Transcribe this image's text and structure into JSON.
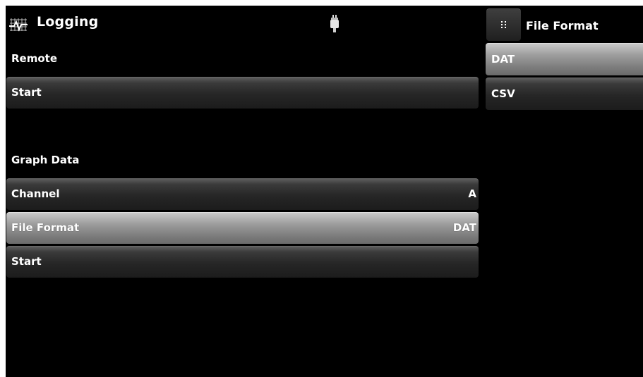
{
  "header": {
    "title": "Logging",
    "title_icon": "logging-graph-icon",
    "status_icon": "usb-connector-icon"
  },
  "remote": {
    "label": "Remote",
    "start_label": "Start"
  },
  "graph": {
    "label": "Graph Data",
    "channel_label": "Channel",
    "channel_value": "A",
    "file_format_label": "File Format",
    "file_format_value": "DAT",
    "start_label": "Start"
  },
  "file_format_panel": {
    "menu_icon": "grid-menu-icon",
    "title": "File Format",
    "options": [
      "DAT",
      "CSV"
    ],
    "selected": "DAT"
  },
  "colors": {
    "background": "#000000",
    "selected_row": "#9e9e9e",
    "row": "#2a2a2a"
  }
}
